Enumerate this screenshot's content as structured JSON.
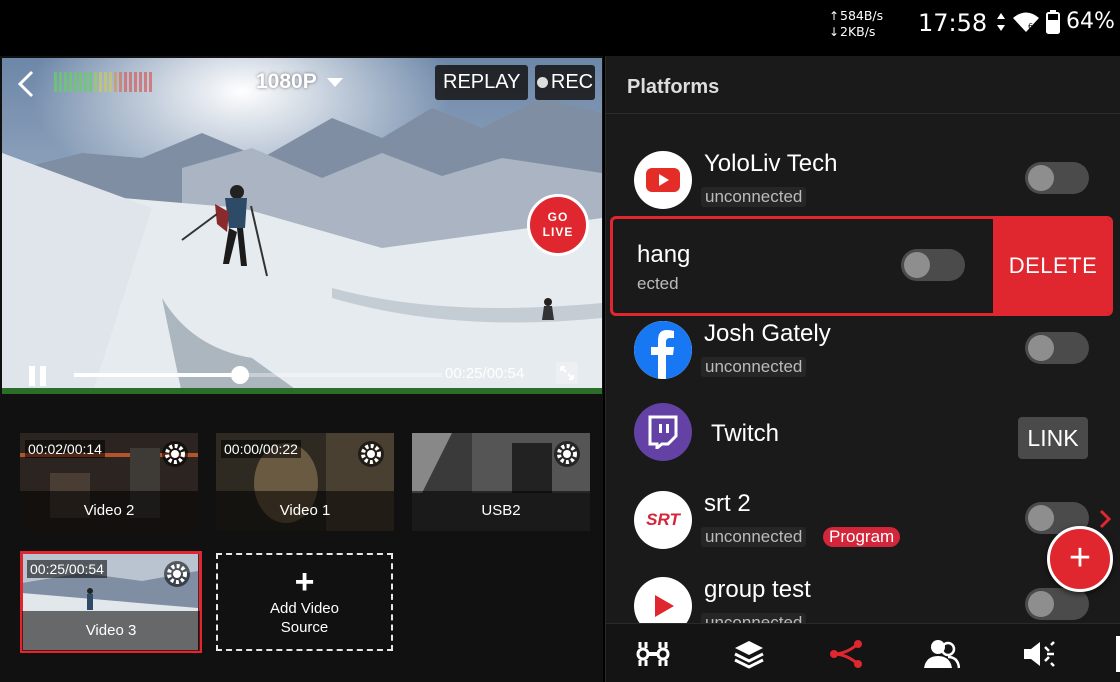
{
  "status_bar": {
    "upload_speed": "584B/s",
    "download_speed": "2KB/s",
    "time": "17:58",
    "battery": "64%"
  },
  "player": {
    "resolution": "1080P",
    "replay_label": "REPLAY",
    "rec_label": "REC",
    "go_live_line1": "GO",
    "go_live_line2": "LIVE",
    "time": "00:25/00:54",
    "progress": 0.45
  },
  "sources": [
    {
      "time": "00:02/00:14",
      "label": "Video 2"
    },
    {
      "time": "00:00/00:22",
      "label": "Video 1"
    },
    {
      "time": "",
      "label": "USB2"
    },
    {
      "time": "00:25/00:54",
      "label": "Video 3",
      "selected": true
    }
  ],
  "add_source": {
    "line1": "Add Video",
    "line2": "Source"
  },
  "platforms_panel": {
    "title": "Platforms",
    "items": [
      {
        "name": "YoloLiv Tech",
        "status": "unconnected",
        "icon": "youtube-icon",
        "control": "toggle",
        "on": false
      },
      {
        "name": "hang",
        "status": "ected",
        "icon": "",
        "control": "toggle",
        "on": false,
        "swiped": true,
        "action": "DELETE"
      },
      {
        "name": "Josh Gately",
        "status": "unconnected",
        "icon": "facebook-icon",
        "control": "toggle",
        "on": false
      },
      {
        "name": "Twitch",
        "status": "",
        "icon": "twitch-icon",
        "control": "link",
        "action": "LINK"
      },
      {
        "name": "srt 2",
        "status": "unconnected",
        "badge": "Program",
        "icon": "srt-icon",
        "control": "toggle",
        "on": false
      },
      {
        "name": "group test",
        "status": "unconnected",
        "icon": "play-icon",
        "control": "toggle",
        "on": false
      }
    ],
    "srt_logo_text": "SRT"
  },
  "colors": {
    "accent": "#e0262e",
    "panel_bg": "#1a1a1a",
    "toggle_off": "#4b4b4b"
  },
  "bottom_tabs": [
    "mixer-icon",
    "layers-icon",
    "share-icon",
    "guests-icon",
    "audio-icon"
  ]
}
